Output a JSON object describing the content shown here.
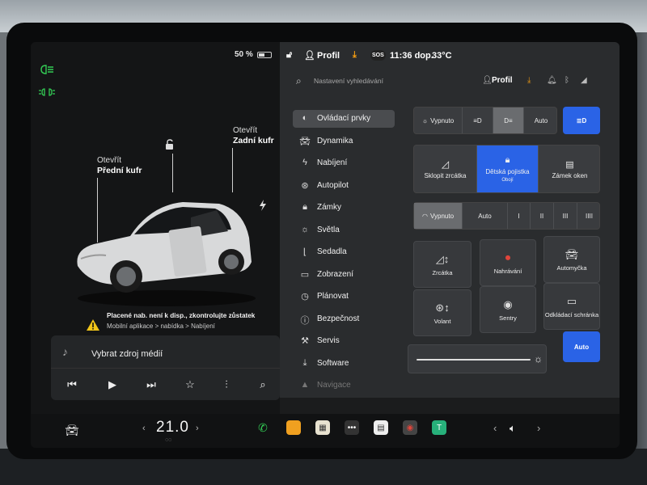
{
  "left": {
    "battery_text": "50 %",
    "battery_level": 0.5,
    "front_trunk": {
      "action": "Otevřít",
      "name": "Přední kufr"
    },
    "rear_trunk": {
      "action": "Otevřít",
      "name": "Zadní kufr"
    },
    "warning": {
      "line1": "Placené nab. není k disp., zkontrolujte zůstatek",
      "line2": "Mobilní aplikace > nabídka > Nabíjení"
    },
    "media": {
      "title": "Vybrat zdroj médií",
      "controls": [
        "previous-icon",
        "play-icon",
        "next-icon",
        "favorite-icon",
        "equalizer-icon",
        "search-icon"
      ]
    }
  },
  "status": {
    "profile": "Profil",
    "time": "11:36 dop.",
    "temperature": "33°C",
    "sos": "SOS"
  },
  "search": {
    "placeholder": "Nastavení vyhledávání",
    "profile": "Profil"
  },
  "menu": [
    {
      "label": "Ovládací prvky",
      "icon": "toggle-icon",
      "active": true
    },
    {
      "label": "Dynamika",
      "icon": "car-icon"
    },
    {
      "label": "Nabíjení",
      "icon": "bolt-icon"
    },
    {
      "label": "Autopilot",
      "icon": "steering-wheel-icon"
    },
    {
      "label": "Zámky",
      "icon": "lock-icon"
    },
    {
      "label": "Světla",
      "icon": "sun-icon"
    },
    {
      "label": "Sedadla",
      "icon": "seat-icon"
    },
    {
      "label": "Zobrazení",
      "icon": "display-icon"
    },
    {
      "label": "Plánovat",
      "icon": "clock-icon"
    },
    {
      "label": "Bezpečnost",
      "icon": "info-icon"
    },
    {
      "label": "Servis",
      "icon": "wrench-icon"
    },
    {
      "label": "Software",
      "icon": "download-icon"
    },
    {
      "label": "Navigace",
      "icon": "navigation-icon",
      "dim": true
    }
  ],
  "controls": {
    "lights": {
      "off": "Vypnuto",
      "auto": "Auto"
    },
    "mirror": "Sklopit zrcátka",
    "child_lock": {
      "label": "Dětská pojistka",
      "state": "Obojí"
    },
    "window_lock": "Zámek oken",
    "wipers": {
      "off": "Vypnuto",
      "auto": "Auto",
      "levels": [
        "I",
        "II",
        "III",
        "IIII"
      ]
    },
    "tiles": {
      "mirrors": "Zrcátka",
      "recording": "Nahrávání",
      "carwash": "Automyčka",
      "wheel": "Volant",
      "sentry": "Sentry",
      "glovebox": "Odkládací schránka"
    },
    "brightness_auto": "Auto",
    "brightness_level": 0.93
  },
  "bottom": {
    "temperature": "21.0",
    "colors": {
      "accent": "#2a63e6",
      "indicator": "#33cc55"
    }
  }
}
